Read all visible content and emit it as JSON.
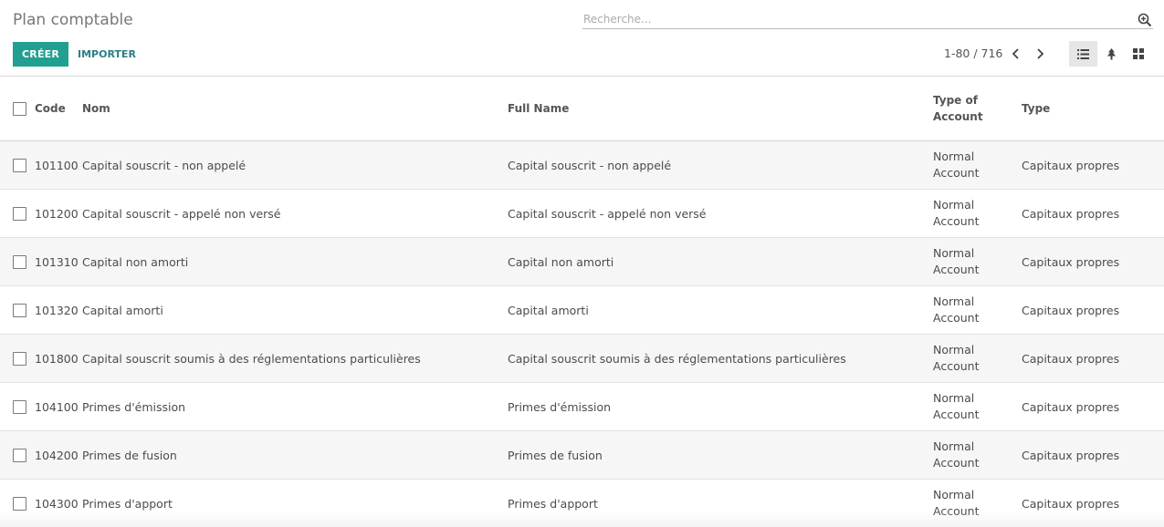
{
  "header": {
    "title": "Plan comptable",
    "search_placeholder": "Recherche...",
    "create_label": "CRÉER",
    "import_label": "IMPORTER",
    "pager": "1-80 / 716"
  },
  "icons": {
    "search": "search-plus-icon",
    "prev": "chevron-left-icon",
    "next": "chevron-right-icon",
    "list": "list-view-icon",
    "tree": "tree-view-icon",
    "kanban": "kanban-view-icon"
  },
  "colors": {
    "accent": "#21a091",
    "link": "#2a7f86"
  },
  "table": {
    "columns": {
      "code": "Code",
      "nom": "Nom",
      "full": "Full Name",
      "toa_line1": "Type of",
      "toa_line2": "Account",
      "type": "Type"
    },
    "rows": [
      {
        "code": "101100",
        "nom": "Capital souscrit - non appelé",
        "full": "Capital souscrit - non appelé",
        "toa1": "Normal",
        "toa2": "Account",
        "type": "Capitaux propres"
      },
      {
        "code": "101200",
        "nom": "Capital souscrit - appelé non versé",
        "full": "Capital souscrit - appelé non versé",
        "toa1": "Normal",
        "toa2": "Account",
        "type": "Capitaux propres"
      },
      {
        "code": "101310",
        "nom": "Capital non amorti",
        "full": "Capital non amorti",
        "toa1": "Normal",
        "toa2": "Account",
        "type": "Capitaux propres"
      },
      {
        "code": "101320",
        "nom": "Capital amorti",
        "full": "Capital amorti",
        "toa1": "Normal",
        "toa2": "Account",
        "type": "Capitaux propres"
      },
      {
        "code": "101800",
        "nom": "Capital souscrit soumis à des réglementations particulières",
        "full": "Capital souscrit soumis à des réglementations particulières",
        "toa1": "Normal",
        "toa2": "Account",
        "type": "Capitaux propres"
      },
      {
        "code": "104100",
        "nom": "Primes d'émission",
        "full": "Primes d'émission",
        "toa1": "Normal",
        "toa2": "Account",
        "type": "Capitaux propres"
      },
      {
        "code": "104200",
        "nom": "Primes de fusion",
        "full": "Primes de fusion",
        "toa1": "Normal",
        "toa2": "Account",
        "type": "Capitaux propres"
      },
      {
        "code": "104300",
        "nom": "Primes d'apport",
        "full": "Primes d'apport",
        "toa1": "Normal",
        "toa2": "Account",
        "type": "Capitaux propres"
      }
    ]
  }
}
